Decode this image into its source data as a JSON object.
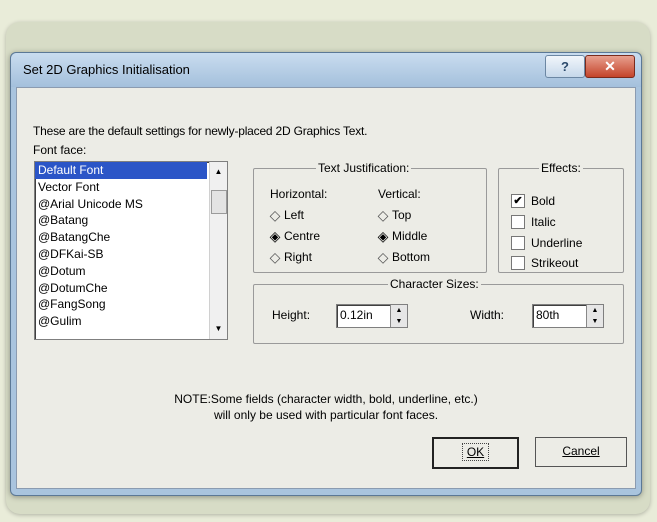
{
  "dialog": {
    "title": "Set 2D Graphics Initialisation",
    "help_label": "?",
    "close_label": "✕",
    "intro": "These are the default settings for newly-placed 2D Graphics Text.",
    "font_face_label": "Font face:",
    "font_list": {
      "selected": "Default Font",
      "items": [
        "Default Font",
        "Vector Font",
        "@Arial Unicode MS",
        "@Batang",
        "@BatangChe",
        "@DFKai-SB",
        "@Dotum",
        "@DotumChe",
        "@FangSong",
        "@Gulim"
      ]
    },
    "justification": {
      "title": "Text Justification:",
      "horizontal_label": "Horizontal:",
      "horizontal_options": [
        "Left",
        "Centre",
        "Right"
      ],
      "horizontal_selected": "Centre",
      "vertical_label": "Vertical:",
      "vertical_options": [
        "Top",
        "Middle",
        "Bottom"
      ],
      "vertical_selected": "Middle"
    },
    "effects": {
      "title": "Effects:",
      "bold": {
        "label": "Bold",
        "checked": true
      },
      "italic": {
        "label": "Italic",
        "checked": false
      },
      "underline": {
        "label": "Underline",
        "checked": false
      },
      "strikeout": {
        "label": "Strikeout",
        "checked": false
      }
    },
    "character_sizes": {
      "title": "Character Sizes:",
      "height_label": "Height:",
      "height_value": "0.12in",
      "width_label": "Width:",
      "width_value": "80th"
    },
    "note_line1": "NOTE:Some fields (character width, bold, underline, etc.)",
    "note_line2": "will only be used with particular font faces.",
    "ok_label": "OK",
    "cancel_label": "Cancel"
  }
}
